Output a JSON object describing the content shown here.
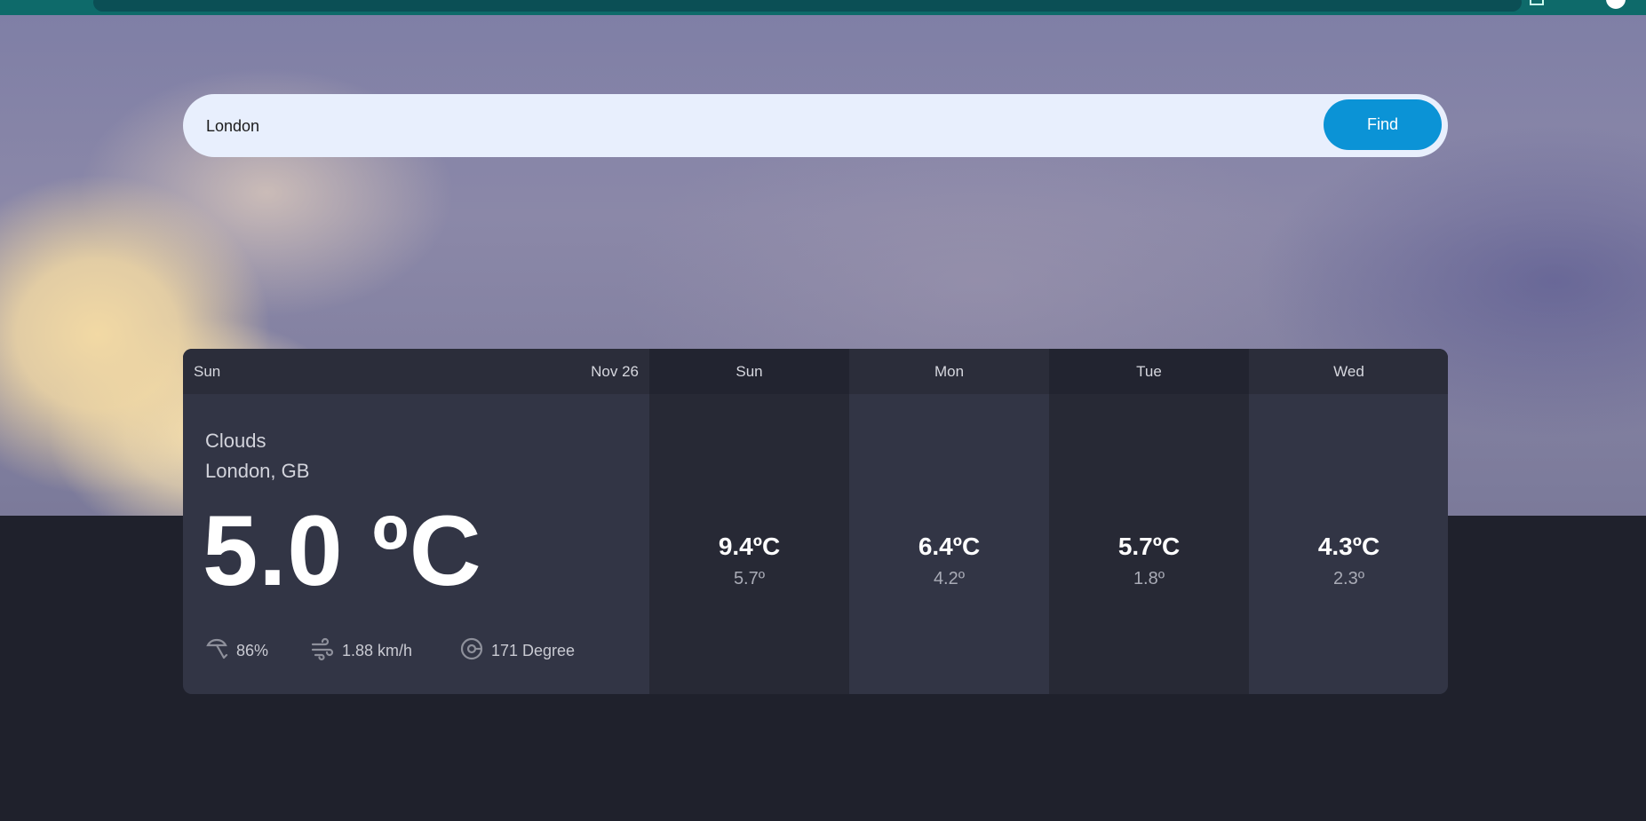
{
  "search": {
    "value": "London",
    "placeholder": "",
    "button_label": "Find"
  },
  "today": {
    "day": "Sun",
    "date": "Nov 26",
    "condition": "Clouds",
    "location": "London, GB",
    "temperature": "5.0 ºC",
    "humidity": "86%",
    "wind": "1.88 km/h",
    "wind_direction": "171 Degree"
  },
  "forecast": [
    {
      "day": "Sun",
      "high": "9.4ºC",
      "low": "5.7º"
    },
    {
      "day": "Mon",
      "high": "6.4ºC",
      "low": "4.2º"
    },
    {
      "day": "Tue",
      "high": "5.7ºC",
      "low": "1.8º"
    },
    {
      "day": "Wed",
      "high": "4.3ºC",
      "low": "2.3º"
    }
  ],
  "icons": {
    "humidity": "umbrella-icon",
    "wind": "wind-icon",
    "direction": "compass-icon"
  },
  "colors": {
    "accent": "#0b93d6",
    "page_bg": "#1f212c",
    "card_bg": "#323545",
    "search_bg": "#e8effd"
  }
}
